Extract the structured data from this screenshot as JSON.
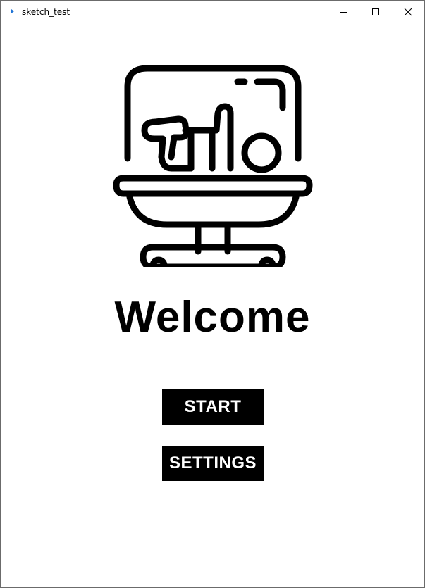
{
  "window": {
    "title": "sketch_test",
    "controls": {
      "minimize": "minimize-icon",
      "maximize": "maximize-icon",
      "close": "close-icon"
    }
  },
  "main": {
    "illustration": "baby-incubator-icon",
    "heading": "Welcome",
    "buttons": {
      "start_label": "START",
      "settings_label": "SETTINGS"
    }
  },
  "colors": {
    "background": "#ffffff",
    "button_bg": "#000000",
    "button_text": "#ffffff",
    "icon_blue": "#1e73d6"
  }
}
